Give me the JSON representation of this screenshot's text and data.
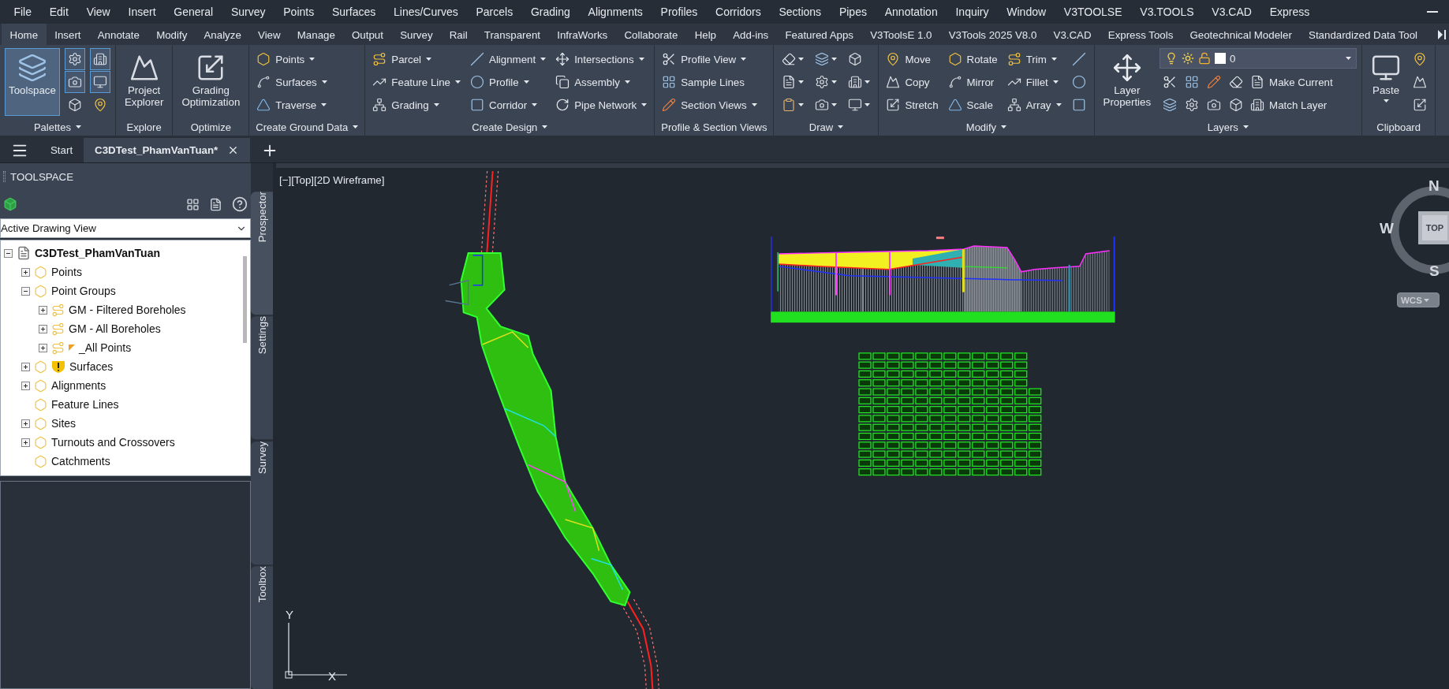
{
  "menu_bar": {
    "items": [
      "File",
      "Edit",
      "View",
      "Insert",
      "General",
      "Survey",
      "Points",
      "Surfaces",
      "Lines/Curves",
      "Parcels",
      "Grading",
      "Alignments",
      "Profiles",
      "Corridors",
      "Sections",
      "Pipes",
      "Annotation",
      "Inquiry",
      "Window",
      "V3TOOLSE",
      "V3.TOOLS",
      "V3.CAD",
      "Express"
    ]
  },
  "ribbon_tabs": [
    {
      "label": "Home",
      "selected": true
    },
    {
      "label": "Insert",
      "selected": false
    },
    {
      "label": "Annotate",
      "selected": false
    },
    {
      "label": "Modify",
      "selected": false
    },
    {
      "label": "Analyze",
      "selected": false
    },
    {
      "label": "View",
      "selected": false
    },
    {
      "label": "Manage",
      "selected": false
    },
    {
      "label": "Output",
      "selected": false
    },
    {
      "label": "Survey",
      "selected": false
    },
    {
      "label": "Rail",
      "selected": false
    },
    {
      "label": "Transparent",
      "selected": false
    },
    {
      "label": "InfraWorks",
      "selected": false
    },
    {
      "label": "Collaborate",
      "selected": false
    },
    {
      "label": "Help",
      "selected": false
    },
    {
      "label": "Add-ins",
      "selected": false
    },
    {
      "label": "Featured Apps",
      "selected": false
    },
    {
      "label": "V3ToolsE 1.0",
      "selected": false
    },
    {
      "label": "V3Tools 2025 V8.0",
      "selected": false
    },
    {
      "label": "V3.CAD",
      "selected": false
    },
    {
      "label": "Express Tools",
      "selected": false
    },
    {
      "label": "Geotechnical Modeler",
      "selected": false
    },
    {
      "label": "Standardized Data Tool",
      "selected": false
    }
  ],
  "ribbon_panels": [
    {
      "title": "Palettes",
      "menu": true,
      "columns": [
        [
          {
            "kind": "large",
            "label": "Toolspace",
            "dropdown": false,
            "active": true
          }
        ],
        [
          {
            "kind": "icon",
            "dropdown": false,
            "active": true
          },
          {
            "kind": "icon",
            "dropdown": false,
            "active": true
          },
          {
            "kind": "icon",
            "dropdown": false,
            "active": false
          }
        ],
        [
          {
            "kind": "icon",
            "dropdown": false,
            "active": true
          },
          {
            "kind": "icon",
            "dropdown": false,
            "active": true
          },
          {
            "kind": "icon",
            "dropdown": false,
            "active": false
          }
        ]
      ]
    },
    {
      "title": "Explore",
      "menu": false,
      "columns": [
        [
          {
            "kind": "large",
            "label": "Project Explorer",
            "dropdown": false
          }
        ]
      ]
    },
    {
      "title": "Optimize",
      "menu": false,
      "columns": [
        [
          {
            "kind": "large",
            "label": "Grading Optimization",
            "dropdown": false
          }
        ]
      ]
    },
    {
      "title": "Create Ground Data",
      "menu": true,
      "columns": [
        [
          {
            "kind": "small",
            "label": "Points",
            "dropdown": true
          },
          {
            "kind": "small",
            "label": "Surfaces",
            "dropdown": true
          },
          {
            "kind": "small",
            "label": "Traverse",
            "dropdown": true
          }
        ]
      ]
    },
    {
      "title": "Create Design",
      "menu": true,
      "columns": [
        [
          {
            "kind": "small",
            "label": "Parcel",
            "dropdown": true
          },
          {
            "kind": "small",
            "label": "Feature Line",
            "dropdown": true
          },
          {
            "kind": "small",
            "label": "Grading",
            "dropdown": true
          }
        ],
        [
          {
            "kind": "small",
            "label": "Alignment",
            "dropdown": true
          },
          {
            "kind": "small",
            "label": "Profile",
            "dropdown": true
          },
          {
            "kind": "small",
            "label": "Corridor",
            "dropdown": true
          }
        ],
        [
          {
            "kind": "small",
            "label": "Intersections",
            "dropdown": true
          },
          {
            "kind": "small",
            "label": "Assembly",
            "dropdown": true
          },
          {
            "kind": "small",
            "label": "Pipe Network",
            "dropdown": true
          }
        ]
      ]
    },
    {
      "title": "Profile & Section Views",
      "menu": false,
      "columns": [
        [
          {
            "kind": "small",
            "label": "Profile View",
            "dropdown": true
          },
          {
            "kind": "small",
            "label": "Sample Lines",
            "dropdown": false
          },
          {
            "kind": "small",
            "label": "Section Views",
            "dropdown": true
          }
        ]
      ]
    },
    {
      "title": "Draw",
      "menu": true,
      "columns": [
        [
          {
            "kind": "icon",
            "dropdown": true
          },
          {
            "kind": "icon",
            "dropdown": true
          },
          {
            "kind": "icon",
            "dropdown": true
          }
        ],
        [
          {
            "kind": "icon",
            "dropdown": true
          },
          {
            "kind": "icon",
            "dropdown": true
          },
          {
            "kind": "icon",
            "dropdown": true
          }
        ],
        [
          {
            "kind": "icon",
            "dropdown": false
          },
          {
            "kind": "icon",
            "dropdown": true
          },
          {
            "kind": "icon",
            "dropdown": true
          }
        ]
      ]
    },
    {
      "title": "Modify",
      "menu": true,
      "columns": [
        [
          {
            "kind": "small",
            "label": "Move",
            "dropdown": false
          },
          {
            "kind": "small",
            "label": "Copy",
            "dropdown": false
          },
          {
            "kind": "small",
            "label": "Stretch",
            "dropdown": false
          }
        ],
        [
          {
            "kind": "small",
            "label": "Rotate",
            "dropdown": false
          },
          {
            "kind": "small",
            "label": "Mirror",
            "dropdown": false
          },
          {
            "kind": "small",
            "label": "Scale",
            "dropdown": false
          }
        ],
        [
          {
            "kind": "small",
            "label": "Trim",
            "dropdown": true
          },
          {
            "kind": "small",
            "label": "Fillet",
            "dropdown": true
          },
          {
            "kind": "small",
            "label": "Array",
            "dropdown": true
          }
        ],
        [
          {
            "kind": "icon",
            "dropdown": false
          },
          {
            "kind": "icon",
            "dropdown": false
          },
          {
            "kind": "icon",
            "dropdown": false
          }
        ]
      ]
    },
    {
      "title": "Layers",
      "menu": true,
      "columns": [
        [
          {
            "kind": "large",
            "label": "Layer Properties",
            "dropdown": false
          }
        ],
        [
          {
            "kind": "combo",
            "value": "0",
            "dropdown": true
          },
          {
            "kind": "row",
            "items": [
              {
                "kind": "icon",
                "dropdown": false
              },
              {
                "kind": "icon",
                "dropdown": false
              },
              {
                "kind": "icon",
                "dropdown": false
              },
              {
                "kind": "icon",
                "dropdown": false
              },
              {
                "kind": "small",
                "label": "Make Current",
                "dropdown": false
              }
            ]
          },
          {
            "kind": "row",
            "items": [
              {
                "kind": "icon",
                "dropdown": false
              },
              {
                "kind": "icon",
                "dropdown": false
              },
              {
                "kind": "icon",
                "dropdown": false
              },
              {
                "kind": "icon",
                "dropdown": false
              },
              {
                "kind": "small",
                "label": "Match Layer",
                "dropdown": false
              }
            ]
          }
        ]
      ]
    },
    {
      "title": "Clipboard",
      "menu": false,
      "columns": [
        [
          {
            "kind": "large",
            "label": "Paste",
            "dropdown": true
          }
        ],
        [
          {
            "kind": "icon",
            "dropdown": false
          },
          {
            "kind": "icon",
            "dropdown": false
          },
          {
            "kind": "icon",
            "dropdown": false
          }
        ]
      ]
    }
  ],
  "file_tabs": [
    {
      "label": "Start",
      "selected": false
    },
    {
      "label": "C3DTest_PhamVanTuan*",
      "selected": true
    }
  ],
  "toolspace": {
    "title": "TOOLSPACE",
    "view_selector": "Active Drawing View",
    "tree": [
      {
        "label": "C3DTest_PhamVanTuan",
        "expandable": true,
        "expanded": true,
        "warning": false,
        "flagged": false,
        "children": [
          {
            "label": "Points",
            "expandable": true,
            "expanded": false,
            "warning": false,
            "flagged": false
          },
          {
            "label": "Point Groups",
            "expandable": true,
            "expanded": true,
            "warning": false,
            "flagged": false,
            "children": [
              {
                "label": "GM - Filtered Boreholes",
                "expandable": true,
                "expanded": false,
                "warning": false,
                "flagged": false
              },
              {
                "label": "GM - All Boreholes",
                "expandable": true,
                "expanded": false,
                "warning": false,
                "flagged": false
              },
              {
                "label": "_All Points",
                "expandable": true,
                "expanded": false,
                "warning": false,
                "flagged": true
              }
            ]
          },
          {
            "label": "Surfaces",
            "expandable": true,
            "expanded": false,
            "warning": true,
            "flagged": false
          },
          {
            "label": "Alignments",
            "expandable": true,
            "expanded": false,
            "warning": false,
            "flagged": false
          },
          {
            "label": "Feature Lines",
            "expandable": false,
            "warning": false,
            "flagged": false
          },
          {
            "label": "Sites",
            "expandable": true,
            "expanded": false,
            "warning": false,
            "flagged": false
          },
          {
            "label": "Turnouts and Crossovers",
            "expandable": true,
            "expanded": false,
            "warning": false,
            "flagged": false
          },
          {
            "label": "Catchments",
            "expandable": false,
            "warning": false,
            "flagged": false
          }
        ]
      }
    ],
    "side_tabs": [
      {
        "label": "Prospector",
        "selected": true
      },
      {
        "label": "Settings",
        "selected": false
      },
      {
        "label": "Survey",
        "selected": false
      },
      {
        "label": "Toolbox",
        "selected": false
      }
    ]
  },
  "viewport": {
    "label": "[−][Top][2D Wireframe]",
    "compass": {
      "north": "N",
      "west": "W",
      "south": "S",
      "view": "TOP"
    },
    "ucs_button": "WCS",
    "axes": {
      "y": "Y",
      "x": "X"
    }
  }
}
